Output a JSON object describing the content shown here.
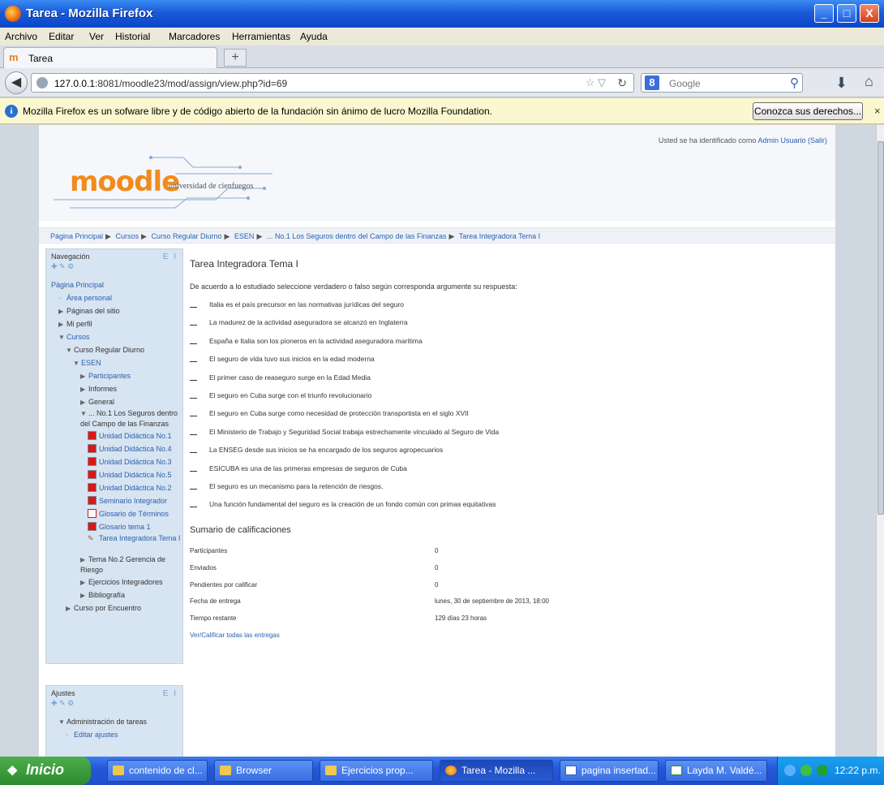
{
  "window": {
    "title": "Tarea - Mozilla Firefox",
    "minimize": "_",
    "maximize": "□",
    "close": "X"
  },
  "menu": [
    "Archivo",
    "Editar",
    "Ver",
    "Historial",
    "Marcadores",
    "Herramientas",
    "Ayuda"
  ],
  "tab": {
    "icon": "m",
    "label": "Tarea",
    "new_tab": "+"
  },
  "nav": {
    "url_host": "127.0.0.1",
    "url_rest": ":8081/moodle23/mod/assign/view.php?id=69",
    "search_placeholder": "Google",
    "search_engine_icon": "8"
  },
  "notification": {
    "message": "Mozilla Firefox es un sofware libre y de código abierto de la fundación sin ánimo de lucro Mozilla Foundation.",
    "button": "Conozca sus derechos...",
    "close": "×"
  },
  "header": {
    "logo_word": "moodle",
    "logo_sub": "universidad de cienfuegos",
    "logged_in_prefix": "Usted se ha identificado como",
    "logged_in_user": "Admin Usuario",
    "logged_in_logout": "(Salir)"
  },
  "breadcrumb": [
    "Página Principal",
    "Cursos",
    "Curso Regular Diurno",
    "ESEN",
    "... No.1 Los Seguros dentro del Campo de las Finanzas",
    "Tarea Integradora Tema I"
  ],
  "nav_block": {
    "title": "Navegación",
    "controls": "E I",
    "items": [
      {
        "text": "Página Principal",
        "type": "link",
        "indent": 0,
        "icon": "none"
      },
      {
        "text": "Área personal",
        "type": "link",
        "indent": 1,
        "icon": "bullet"
      },
      {
        "text": "Páginas del sitio",
        "type": "text",
        "indent": 1,
        "icon": "arrow-right"
      },
      {
        "text": "Mi perfil",
        "type": "text",
        "indent": 1,
        "icon": "arrow-right"
      },
      {
        "text": "Cursos",
        "type": "link",
        "indent": 1,
        "icon": "arrow-down"
      },
      {
        "text": "Curso Regular Diurno",
        "type": "text",
        "indent": 2,
        "icon": "arrow-down"
      },
      {
        "text": "ESEN",
        "type": "link",
        "indent": 3,
        "icon": "arrow-down"
      },
      {
        "text": "Participantes",
        "type": "link",
        "indent": 4,
        "icon": "arrow-right"
      },
      {
        "text": "Informes",
        "type": "text",
        "indent": 4,
        "icon": "arrow-right"
      },
      {
        "text": "General",
        "type": "text",
        "indent": 4,
        "icon": "arrow-right"
      },
      {
        "text": "... No.1 Los Seguros dentro del Campo de las Finanzas",
        "type": "text",
        "indent": 4,
        "icon": "arrow-down",
        "tall": true
      },
      {
        "text": "Unidad Didáctica No.1",
        "type": "link",
        "indent": 5,
        "icon": "pdf"
      },
      {
        "text": "Unidad Didáctica No.4",
        "type": "link",
        "indent": 5,
        "icon": "pdf"
      },
      {
        "text": "Unidad Didáctica No.3",
        "type": "link",
        "indent": 5,
        "icon": "pdf"
      },
      {
        "text": "Unidad Didáctica No.5",
        "type": "link",
        "indent": 5,
        "icon": "pdf"
      },
      {
        "text": "Unidad Didáctica No.2",
        "type": "link",
        "indent": 5,
        "icon": "pdf"
      },
      {
        "text": "Seminario Integrador",
        "type": "link",
        "indent": 5,
        "icon": "pdf"
      },
      {
        "text": "Glosario de Términos",
        "type": "link",
        "indent": 5,
        "icon": "pdf-white"
      },
      {
        "text": "Glosario tema 1",
        "type": "link",
        "indent": 5,
        "icon": "pdf"
      },
      {
        "text": "Tarea Integradora Tema I",
        "type": "link",
        "indent": 5,
        "icon": "assign",
        "tall": true
      },
      {
        "text": "Tema No.2 Gerencia de Riesgo",
        "type": "text",
        "indent": 4,
        "icon": "arrow-right",
        "tall": true
      },
      {
        "text": "Ejercicios Integradores",
        "type": "text",
        "indent": 4,
        "icon": "arrow-right"
      },
      {
        "text": "Bibliografía",
        "type": "text",
        "indent": 4,
        "icon": "arrow-right"
      },
      {
        "text": "Curso por Encuentro",
        "type": "text",
        "indent": 2,
        "icon": "arrow-right"
      }
    ]
  },
  "settings_block": {
    "title": "Ajustes",
    "controls": "E I",
    "items": [
      {
        "text": "Administración de tareas",
        "type": "text",
        "indent": 1,
        "icon": "arrow-down"
      },
      {
        "text": "Editar ajustes",
        "type": "link",
        "indent": 2,
        "icon": "bullet"
      }
    ]
  },
  "main": {
    "title": "Tarea Integradora Tema I",
    "intro": "De acuerdo a lo estudiado seleccione verdadero o falso según corresponda argumente su respuesta:",
    "questions": [
      "Italia es el país precursor en las normativas jurídicas del seguro",
      "La madurez de la actividad aseguradora se alcanzó en Inglaterra",
      "España e Italia son los pioneros en la actividad aseguradora marítima",
      "El seguro de vida tuvo sus inicios en la edad moderna",
      "El primer caso de reaseguro surge en la Edad Media",
      "El seguro en Cuba surge con el triunfo revolucionario",
      "El seguro en Cuba surge como necesidad de protección transportista en el siglo XVII",
      "El Ministerio de Trabajo y Seguridad Social trabaja estrechamente vinculado al Seguro de Vida",
      "La ENSEG desde sus inicios se ha encargado de los seguros agropecuarios",
      "ESICUBA es una de las primeras empresas de seguros de Cuba",
      "El seguro es un mecanismo para la retención de riesgos.",
      "Una función fundamental del seguro es la creación de un fondo común con primas equitativas"
    ],
    "summary_title": "Sumario de calificaciones",
    "summary_rows": [
      {
        "label": "Participantes",
        "value": "0"
      },
      {
        "label": "Enviados",
        "value": "0"
      },
      {
        "label": "Pendientes por calificar",
        "value": "0"
      },
      {
        "label": "Fecha de entrega",
        "value": "lunes, 30 de septiembre de 2013, 18:00"
      },
      {
        "label": "Tiempo restante",
        "value": "129 días 23 horas"
      }
    ],
    "view_all": "Ver/Calificar todas las entregas"
  },
  "taskbar": {
    "start": "Inicio",
    "buttons": [
      {
        "label": "contenido de cl...",
        "icon": "folder"
      },
      {
        "label": "Browser",
        "icon": "folder"
      },
      {
        "label": "Ejercicios prop...",
        "icon": "folder"
      },
      {
        "label": "Tarea - Mozilla ...",
        "icon": "fx",
        "active": true
      },
      {
        "label": "pagina insertad...",
        "icon": "doc"
      },
      {
        "label": "Layda M. Valdé...",
        "icon": "app"
      }
    ],
    "clock": "12:22 p.m."
  },
  "colors": {
    "link": "#2a5fb0",
    "sidebar_bg": "#d7e4f1",
    "moodle_orange": "#f28a1c",
    "xp_blue": "#2558d8"
  }
}
